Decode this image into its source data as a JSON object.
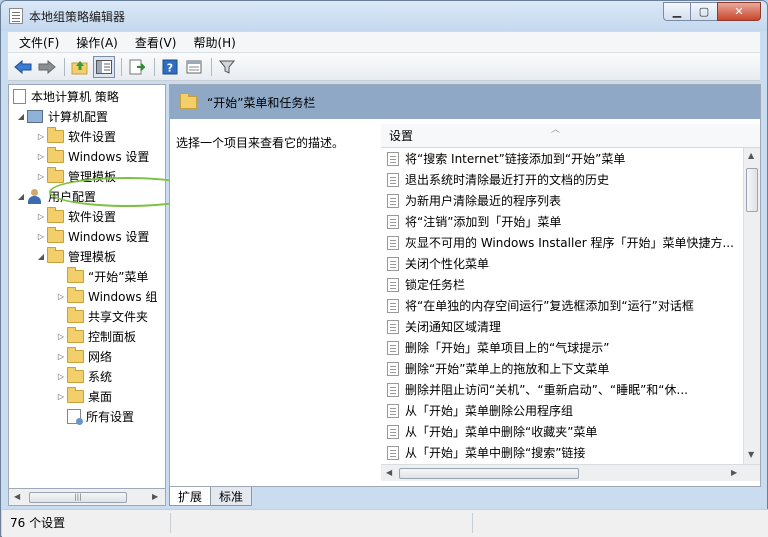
{
  "window": {
    "title": "本地组策略编辑器"
  },
  "menu": {
    "items": [
      "文件(F)",
      "操作(A)",
      "查看(V)",
      "帮助(H)"
    ]
  },
  "toolbar": {
    "icons": [
      "back-arrow-icon",
      "forward-arrow-icon",
      "up-folder-icon",
      "show-hide-tree-icon",
      "export-list-icon",
      "help-icon",
      "properties-icon",
      "filter-icon"
    ]
  },
  "tree": {
    "root": "本地计算机 策略",
    "computer_config": "计算机配置",
    "computer_children": [
      "软件设置",
      "Windows 设置",
      "管理模板"
    ],
    "user_config": "用户配置",
    "user_children": [
      "软件设置",
      "Windows 设置",
      "管理模板"
    ],
    "admin_templates_children": [
      "“开始”菜单",
      "Windows 组",
      "共享文件夹",
      "控制面板",
      "网络",
      "系统",
      "桌面",
      "所有设置"
    ]
  },
  "details": {
    "header_title": "“开始”菜单和任务栏",
    "hint": "选择一个项目来查看它的描述。",
    "column_header": "设置",
    "settings": [
      "将“搜索 Internet”链接添加到“开始”菜单",
      "退出系统时清除最近打开的文档的历史",
      "为新用户清除最近的程序列表",
      "将“注销”添加到「开始」菜单",
      "灰显不可用的 Windows Installer 程序「开始」菜单快捷方...",
      "关闭个性化菜单",
      "锁定任务栏",
      "将“在单独的内存空间运行”复选框添加到“运行”对话框",
      "关闭通知区域清理",
      "删除「开始」菜单项目上的“气球提示”",
      "删除“开始”菜单上的拖放和上下文菜单",
      "删除并阻止访问“关机”、“重新启动”、“睡眠”和“休...",
      "从「开始」菜单删除公用程序组",
      "从「开始」菜单中删除“收藏夹”菜单",
      "从「开始」菜单中删除“搜索”链接"
    ]
  },
  "tabs": [
    "扩展",
    "标准"
  ],
  "status": {
    "text": "76 个设置"
  },
  "colors": {
    "header_bar": "#8ea8c6",
    "highlight_ellipse": "#7cc142"
  }
}
